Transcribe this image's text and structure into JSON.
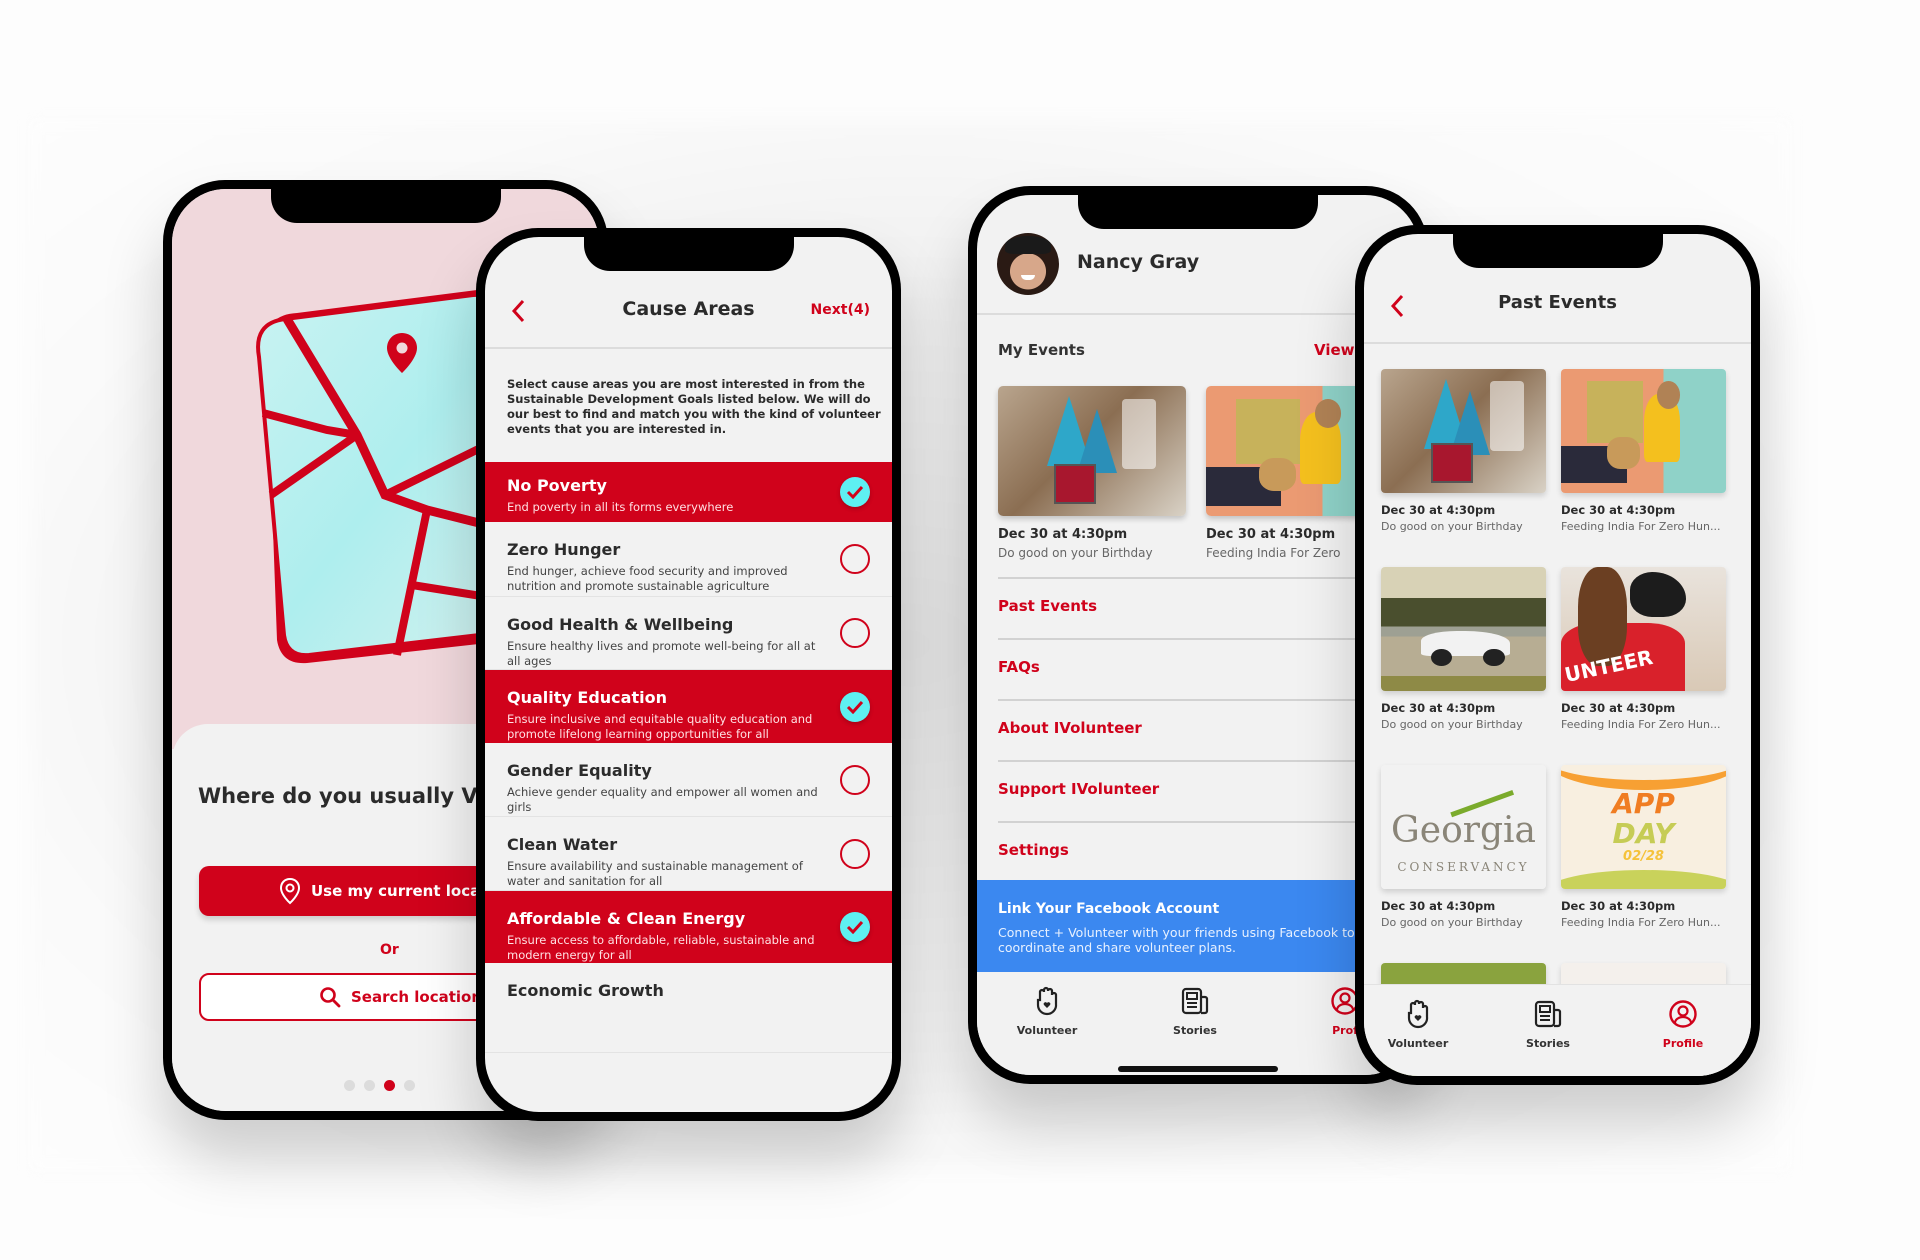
{
  "brand": {
    "accent": "#d0021b",
    "check_fill": "#5ef0f2",
    "facebook_blue": "#3b88f0"
  },
  "location_screen": {
    "question": "Where do you usually Volu",
    "use_location_label": "Use my current locatio",
    "or_label": "Or",
    "search_label": "Search location",
    "pager": {
      "total": 4,
      "active": 3
    }
  },
  "cause_screen": {
    "title": "Cause Areas",
    "next_label": "Next(4)",
    "intro": "Select cause areas you are most interested in from the Sustainable Development Goals listed below. We will do our best to find and match you with the kind of volunteer events that you are interested in.",
    "causes": [
      {
        "title": "No Poverty",
        "desc": "End poverty in all its forms everywhere",
        "selected": true
      },
      {
        "title": "Zero Hunger",
        "desc": "End hunger, achieve food security and improved nutrition and promote sustainable agriculture",
        "selected": false
      },
      {
        "title": "Good Health & Wellbeing",
        "desc": "Ensure healthy lives and promote well-being for all at all ages",
        "selected": false
      },
      {
        "title": "Quality Education",
        "desc": "Ensure inclusive and equitable quality education and promote lifelong learning opportunities for all",
        "selected": true
      },
      {
        "title": "Gender Equality",
        "desc": "Achieve gender equality and empower all women and girls",
        "selected": false
      },
      {
        "title": "Clean Water",
        "desc": "Ensure availability and sustainable management of water and sanitation for all",
        "selected": false
      },
      {
        "title": "Affordable & Clean Energy",
        "desc": "Ensure access to affordable, reliable, sustainable and modern energy for all",
        "selected": true
      },
      {
        "title": "Economic Growth",
        "desc": "",
        "selected": false
      }
    ]
  },
  "profile_screen": {
    "name": "Nancy Gray",
    "my_events_label": "My Events",
    "view_label": "View",
    "events": [
      {
        "date": "Dec 30 at 4:30pm",
        "name": "Do good on your Birthday",
        "image": "party-hats"
      },
      {
        "date": "Dec 30 at 4:30pm",
        "name": "Feeding India For Zero",
        "image": "dog-feeding"
      }
    ],
    "menu": [
      "Past Events",
      "FAQs",
      "About IVolunteer",
      "Support IVolunteer",
      "Settings"
    ],
    "facebook": {
      "title": "Link Your Facebook Account",
      "desc": "Connect + Volunteer with your friends using Facebook to easily coordinate and share volunteer plans."
    }
  },
  "past_events_screen": {
    "title": "Past Events",
    "events": [
      {
        "date": "Dec 30 at 4:30pm",
        "name": "Do good on your Birthday",
        "image": "party-hats"
      },
      {
        "date": "Dec 30 at 4:30pm",
        "name": "Feeding India For Zero Hun...",
        "image": "dog-feeding"
      },
      {
        "date": "Dec 30 at 4:30pm",
        "name": "Do good on your Birthday",
        "image": "race-car"
      },
      {
        "date": "Dec 30 at 4:30pm",
        "name": "Feeding India For Zero Hun...",
        "image": "volunteer-dog"
      },
      {
        "date": "Dec 30 at 4:30pm",
        "name": "Do good on your Birthday",
        "image": "georgia-conservancy"
      },
      {
        "date": "Dec 30 at 4:30pm",
        "name": "Feeding India For Zero Hun...",
        "image": "app-day"
      }
    ],
    "georgia_logo": {
      "line1": "Georgia",
      "line2": "CONSERVANCY"
    },
    "app_day": {
      "line1": "APP",
      "line2": "DAY",
      "line3": "02/28"
    }
  },
  "tabbar": {
    "tabs": [
      {
        "label": "Volunteer",
        "icon": "hand-heart-icon"
      },
      {
        "label": "Stories",
        "icon": "newspaper-icon"
      },
      {
        "label": "Profile",
        "icon": "user-circle-icon"
      }
    ],
    "active": "Profile",
    "profile_cut_label": "Prof"
  }
}
